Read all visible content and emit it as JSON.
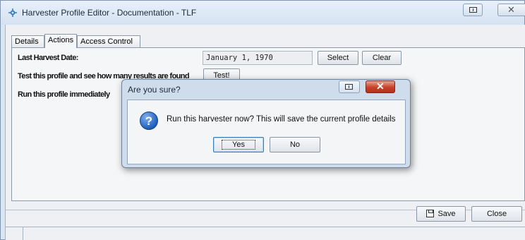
{
  "window": {
    "title": "Harvester Profile Editor - Documentation - TLF",
    "app_icon": "gear-icon",
    "restore_icon": "restore-icon",
    "close_icon": "close-icon"
  },
  "tabs": [
    {
      "label": "Details",
      "active": false
    },
    {
      "label": "Actions",
      "active": true
    },
    {
      "label": "Access Control",
      "active": false
    }
  ],
  "actions": {
    "last_harvest_label": "Last Harvest Date:",
    "last_harvest_value": "January 1, 1970",
    "select_label": "Select",
    "clear_label": "Clear",
    "test_label": "Test this profile and see how many results are found",
    "test_button": "Test!",
    "run_label": "Run this profile immediately"
  },
  "footer": {
    "save_label": "Save",
    "close_label": "Close"
  },
  "dialog": {
    "title": "Are you sure?",
    "message": "Run this harvester now? This will save the current profile details",
    "yes_label": "Yes",
    "no_label": "No",
    "icon": "question-icon",
    "close_color": "#c8412a"
  }
}
